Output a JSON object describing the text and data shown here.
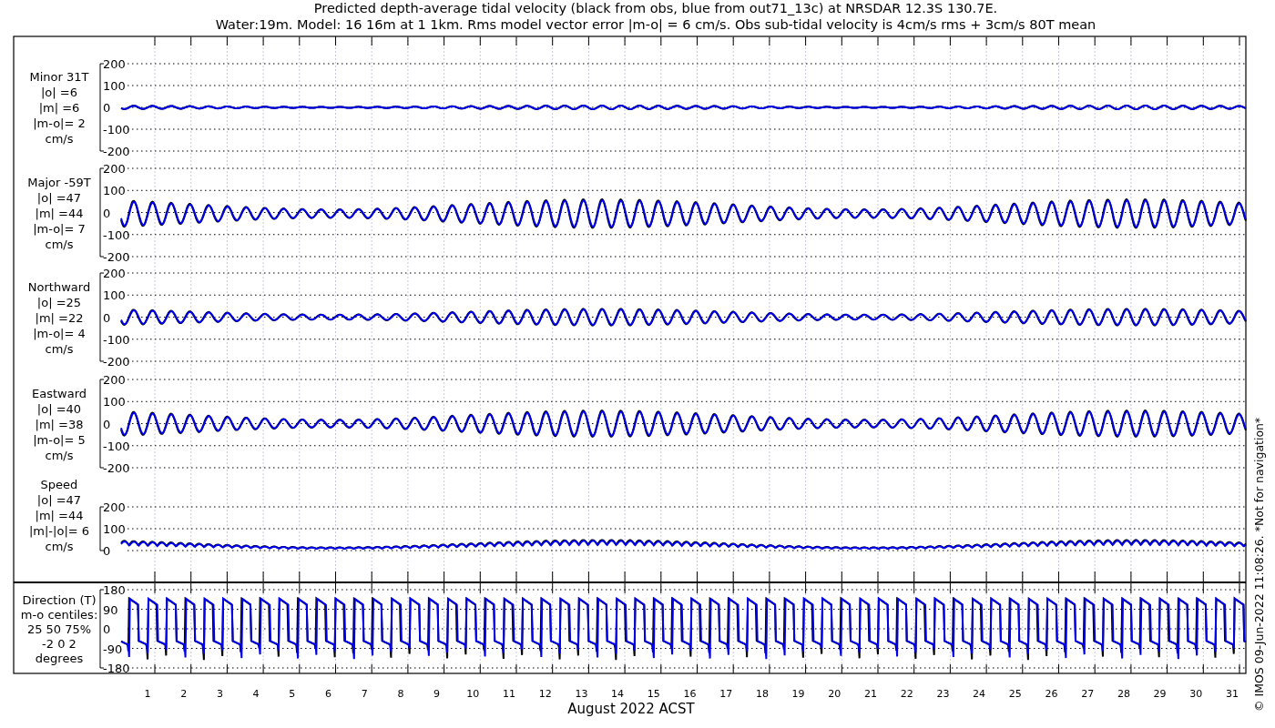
{
  "title_lines": [
    "Predicted depth-average tidal velocity (black from obs, blue from out71_13c) at NRSDAR 12.3S 130.7E.",
    "Water:19m. Model: 16 16m at 1 1km. Rms model vector error |m-o| = 6 cm/s. Obs sub-tidal velocity is 4cm/s rms + 3cm/s 80T mean"
  ],
  "panels": [
    {
      "kind": "signed",
      "label_lines": [
        "Minor 31T",
        "|o| =6",
        "|m| =6",
        "|m-o|= 2",
        "cm/s"
      ],
      "yticks": [
        "200",
        "100",
        "0",
        "-100",
        "-200"
      ]
    },
    {
      "kind": "signed",
      "label_lines": [
        "Major -59T",
        "|o| =47",
        "|m| =44",
        "|m-o|= 7",
        "cm/s"
      ],
      "yticks": [
        "200",
        "100",
        "0",
        "-100",
        "-200"
      ]
    },
    {
      "kind": "signed",
      "label_lines": [
        "Northward",
        "|o| =25",
        "|m| =22",
        "|m-o|= 4",
        "cm/s"
      ],
      "yticks": [
        "200",
        "100",
        "0",
        "-100",
        "-200"
      ]
    },
    {
      "kind": "signed",
      "label_lines": [
        "Eastward",
        "|o| =40",
        "|m| =38",
        "|m-o|= 5",
        "cm/s"
      ],
      "yticks": [
        "200",
        "100",
        "0",
        "-100",
        "-200"
      ]
    },
    {
      "kind": "speed",
      "label_lines": [
        "Speed",
        "|o| =47",
        "|m| =44",
        "|m|-|o|= 6",
        "cm/s"
      ],
      "yticks": [
        "200",
        "100",
        "0"
      ]
    },
    {
      "kind": "direction",
      "label_lines": [
        "Direction (T)",
        "m-o centiles:",
        "25  50  75%",
        "-2  0  2",
        "degrees"
      ],
      "yticks": [
        "180",
        "90",
        "0",
        "-90",
        "-180"
      ]
    }
  ],
  "days": [
    "1",
    "2",
    "3",
    "4",
    "5",
    "6",
    "7",
    "8",
    "9",
    "10",
    "11",
    "12",
    "13",
    "14",
    "15",
    "16",
    "17",
    "18",
    "19",
    "20",
    "21",
    "22",
    "23",
    "24",
    "25",
    "26",
    "27",
    "28",
    "29",
    "30",
    "31"
  ],
  "xlabel": "August 2022 ACST",
  "footer": "© IMOS 09-Jun-2022 11:08:26. *Not for navigation*"
}
